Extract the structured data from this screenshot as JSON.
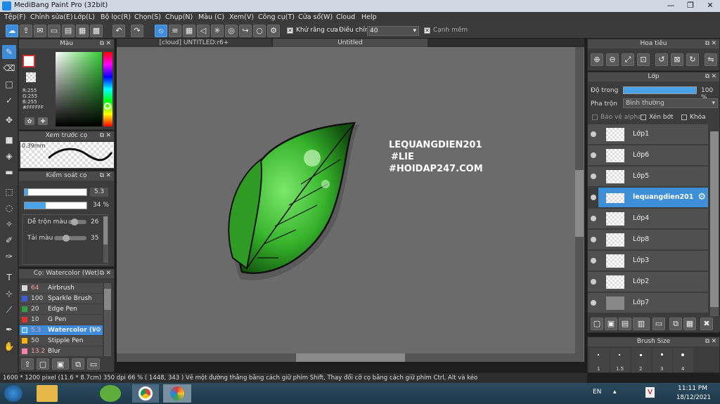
{
  "window": {
    "title": "MediBang Paint Pro (32bit)"
  },
  "menu": [
    "Tệp(F)",
    "Chỉnh sửa(E)",
    "Lớp(L)",
    "Bộ lọc(R)",
    "Chọn(S)",
    "Chụp(N)",
    "Màu (C)",
    "Xem(V)",
    "Công cụ(T)",
    "Cửa sổ(W)",
    "Cloud",
    "Help"
  ],
  "toolbar": {
    "antialias_label": "Khử răng cưa",
    "adjust_label": "Điều chỉnh",
    "adjust_value": "40",
    "edge_label": "Cạnh mềm"
  },
  "tabs": [
    "[cloud] UNTITLED:r6+",
    "Untitled"
  ],
  "color_panel": {
    "title": "Màu",
    "r": "R:255",
    "g": "G:255",
    "b": "B:255",
    "hex": "#FFFFFF"
  },
  "preview_panel": {
    "title": "Xem trước cọ",
    "size": "0.39mm"
  },
  "brush_control": {
    "title": "Kiểm soát cọ",
    "size_value": "5.3",
    "opacity_value": "34 %",
    "blend_label": "Dễ trộn màu",
    "blend_value": "26",
    "density_label": "Tải màu",
    "density_value": "35"
  },
  "brush_list": {
    "title": "Cọ: Watercolor (Wet)",
    "items": [
      {
        "size": "64",
        "name": "Airbrush",
        "color": "#d8d8d8"
      },
      {
        "size": "100",
        "name": "Sparkle Brush",
        "color": "#3b5bdb"
      },
      {
        "size": "20",
        "name": "Edge Pen",
        "color": "#2f9e44"
      },
      {
        "size": "10",
        "name": "G Pen",
        "color": "#e03131"
      },
      {
        "size": "5.3",
        "name": "Watercolor (Wet)",
        "color": "#4dabf7"
      },
      {
        "size": "50",
        "name": "Stipple Pen",
        "color": "#fab005"
      },
      {
        "size": "13.2",
        "name": "Blur",
        "color": "#f783ac"
      }
    ]
  },
  "navigator": {
    "title": "Hoa tiêu"
  },
  "layers_panel": {
    "title": "Lớp",
    "opacity_label": "Độ trong",
    "opacity_value": "100 %",
    "opacity_fraction": 1.0,
    "blend_label": "Pha trộn",
    "blend_value": "Bình thường",
    "protect_alpha": "Bảo vệ alpha",
    "clip": "Xén bớt",
    "lock": "Khóa",
    "layers": [
      {
        "name": "Lớp1",
        "selected": false
      },
      {
        "name": "Lớp6",
        "selected": false
      },
      {
        "name": "Lớp5",
        "selected": false
      },
      {
        "name": "lequangdien201",
        "selected": true
      },
      {
        "name": "Lớp4",
        "selected": false
      },
      {
        "name": "Lớp8",
        "selected": false
      },
      {
        "name": "Lớp3",
        "selected": false
      },
      {
        "name": "Lớp2",
        "selected": false
      },
      {
        "name": "Lớp7",
        "selected": false
      }
    ]
  },
  "brush_size_panel": {
    "title": "Brush Size",
    "sizes": [
      "1",
      "1.5",
      "2",
      "3",
      "4"
    ]
  },
  "canvas_text": [
    "LEQUANGDIEN201",
    "#LIE",
    "#HOIDAP247.COM"
  ],
  "status": {
    "text": "1600 * 1200 pixel   (11.6 * 8.7cm)   350 dpi   66 %   ( 1448, 343 )   Vẽ một đường thẳng bằng cách giữ phím Shift, Thay đổi cỡ cọ bằng cách giữ phím Ctrl, Alt và kéo"
  },
  "taskbar": {
    "lang": "EN",
    "time": "11:11 PM",
    "date": "18/12/2021"
  }
}
